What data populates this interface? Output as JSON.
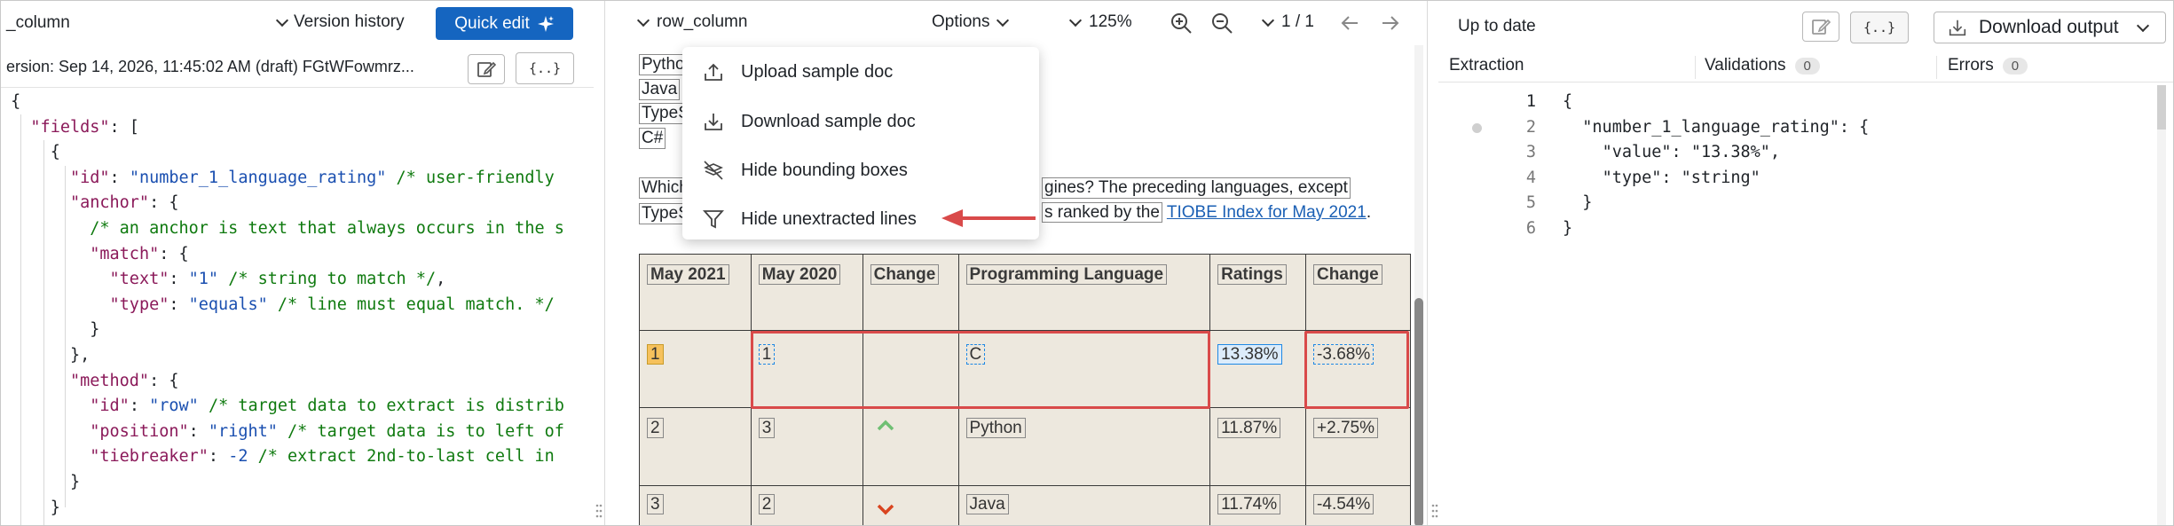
{
  "left": {
    "title": "_column",
    "version_history_label": "Version history",
    "quick_edit_label": "Quick edit",
    "version_line": "ersion: Sep 14, 2026, 11:45:02 AM (draft) FGtWFowmrz...",
    "code_button_label": "{..}",
    "code_lines": [
      "{",
      "  \"fields\": [",
      "    {",
      "      \"id\": \"number_1_language_rating\" /* user-friendly",
      "      \"anchor\": {",
      "        /* an anchor is text that always occurs in the s",
      "        \"match\": {",
      "          \"text\": \"1\" /* string to match */,",
      "          \"type\": \"equals\" /* line must equal match. */",
      "        }",
      "      },",
      "      \"method\": {",
      "        \"id\": \"row\" /* target data to extract is distrib",
      "        \"position\": \"right\" /* target data is to left of",
      "        \"tiebreaker\": -2 /* extract 2nd-to-last cell in",
      "      }",
      "    }"
    ]
  },
  "middle": {
    "toolbar": {
      "config_name": "row_column",
      "options_label": "Options",
      "zoom": "125%",
      "page": "1 / 1"
    },
    "menu": [
      "Upload sample doc",
      "Download sample doc",
      "Hide bounding boxes",
      "Hide unextracted lines"
    ],
    "doc": {
      "list": [
        "Pytho",
        "Java",
        "TypeS",
        "C#"
      ],
      "para_line1_a": "Which",
      "para_line1_b": "gines? The preceding languages, except",
      "para_line2_a": "TypeS",
      "para_line2_b": "s ranked by the",
      "link": "TIOBE Index for May 2021",
      "para_end": "."
    },
    "table": {
      "headers": [
        "May 2021",
        "May 2020",
        "Change",
        "Programming Language",
        "Ratings",
        "Change"
      ],
      "rows": [
        [
          "1",
          "1",
          "",
          "C",
          "13.38%",
          "-3.68%"
        ],
        [
          "2",
          "3",
          "up",
          "Python",
          "11.87%",
          "+2.75%"
        ],
        [
          "3",
          "2",
          "down",
          "Java",
          "11.74%",
          "-4.54%"
        ]
      ]
    }
  },
  "right": {
    "status": "Up to date",
    "download_label": "Download output",
    "code_button_label": "{..}",
    "tabs": [
      {
        "label": "Extraction",
        "count": ""
      },
      {
        "label": "Validations",
        "count": "0"
      },
      {
        "label": "Errors",
        "count": "0"
      }
    ],
    "json_lines": [
      {
        "num": "1",
        "text": "{"
      },
      {
        "num": "2",
        "text": "  \"number_1_language_rating\": {"
      },
      {
        "num": "3",
        "text": "    \"value\": \"13.38%\","
      },
      {
        "num": "4",
        "text": "    \"type\": \"string\""
      },
      {
        "num": "5",
        "text": "  }"
      },
      {
        "num": "6",
        "text": "}"
      }
    ]
  },
  "colors": {
    "accent": "#1565c0",
    "highlight_red": "#d94a4a",
    "table_bg": "#ede8de",
    "selected_blue": "#1e88e5",
    "anchor_yellow": "#f6c15c"
  }
}
